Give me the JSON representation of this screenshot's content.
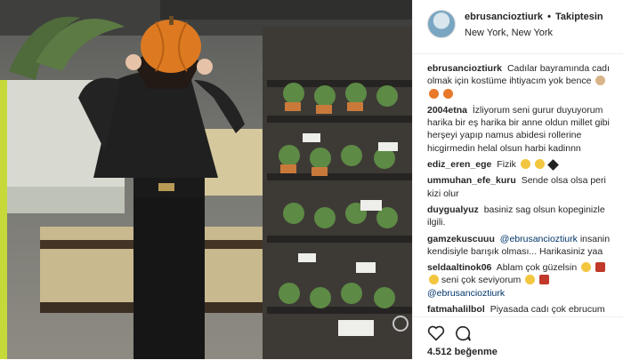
{
  "post": {
    "username": "ebrusancioztiurk",
    "separator": "•",
    "follow_label": "Takiptesin",
    "location": "New York, New York"
  },
  "comments": [
    {
      "user": "ebrusancioztiurk",
      "text": "Cadılar bayramında cadı olmak için kostüme ihtiyacım yok bence",
      "emojis": [
        "woman-icon",
        "pumpkin-icon",
        "pumpkin-icon"
      ]
    },
    {
      "user": "2004etna",
      "text": "İzliyorum seni gurur duyuyorum harika bir eş harika bir anne oldun millet gibi herşeyi yapıp namus abidesi rollerine hicgirmedin helal olsun harbi kadinnn",
      "emojis": []
    },
    {
      "user": "ediz_eren_ege",
      "text": "Fizik",
      "emojis": [
        "heart-eyes-icon",
        "sunglasses-icon",
        "black-heart-icon"
      ]
    },
    {
      "user": "ummuhan_efe_kuru",
      "text": "Sende olsa olsa peri kizi olur",
      "emojis": []
    },
    {
      "user": "duygualyuz",
      "text": "basiniz sag olsun kopeginizle ilgili.",
      "emojis": []
    },
    {
      "user": "gamzekuscuuu",
      "mention": "@ebrusancioztiurk",
      "text": "insanin kendisiyle barışık olması... Harikasiniz yaa",
      "emojis": []
    },
    {
      "user": "seldaaltinok06",
      "text": "Ablam çok güzelsin",
      "emojis": [
        "heart-eyes-icon",
        "heart-icon"
      ],
      "line2": "seni çok seviyorum",
      "mention2": "@ebrusancioztiurk"
    },
    {
      "user": "fatmahalilbol",
      "text": "Piyasada cadı çok ebrucum",
      "emojis": []
    }
  ],
  "actions": {
    "likes": "4.512 beğenme"
  },
  "colors": {
    "text": "#262626",
    "mention": "#003569",
    "border": "#efefef"
  }
}
